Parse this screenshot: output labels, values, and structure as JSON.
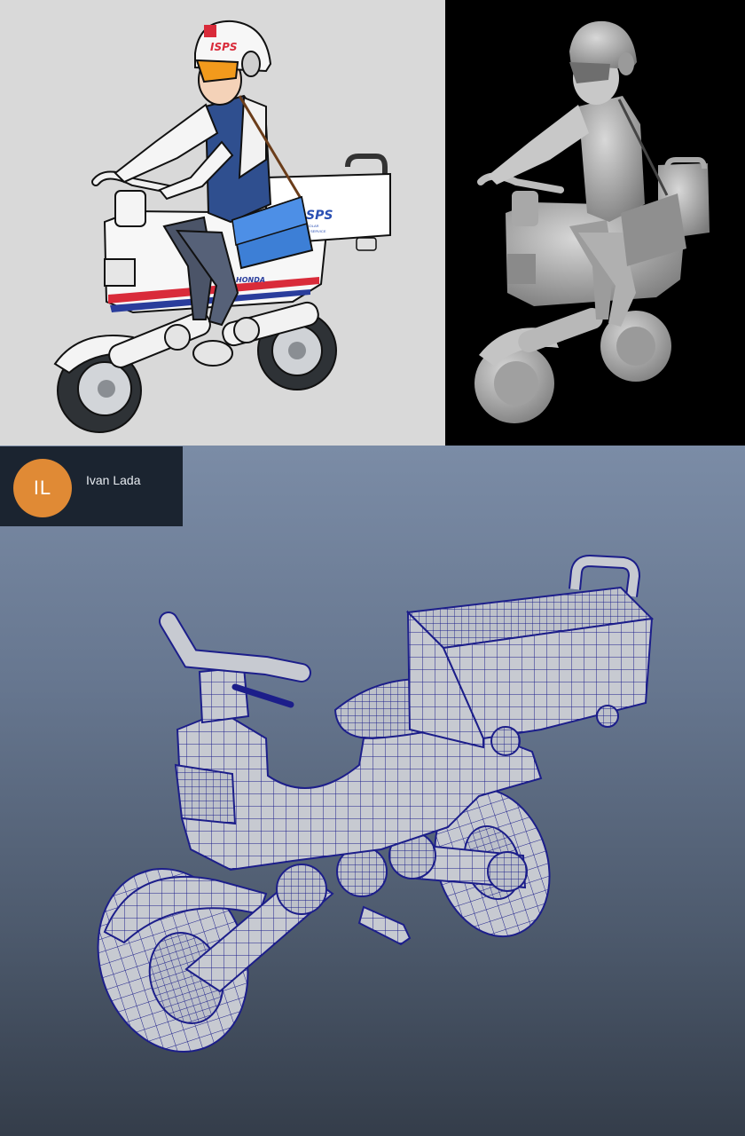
{
  "author": {
    "initials": "IL",
    "name": "Ivan Lada",
    "avatar_color": "#e08a35"
  },
  "decals": {
    "helmet": "ISPS",
    "box": "SPS",
    "box_small_1": "R SOLAR",
    "box_small_2": "TAL SERVICE",
    "brand": "HONDA"
  },
  "colors": {
    "toon_bg": "#d9d9d9",
    "clay_bg": "#000000",
    "wire_bg_top": "#7b8ca6",
    "wire_bg_bottom": "#343d4a",
    "wire_line": "#1c1e8a",
    "stripe_red": "#d92b3a",
    "stripe_blue": "#2a3d9c",
    "bag": "#3d7fd6"
  }
}
